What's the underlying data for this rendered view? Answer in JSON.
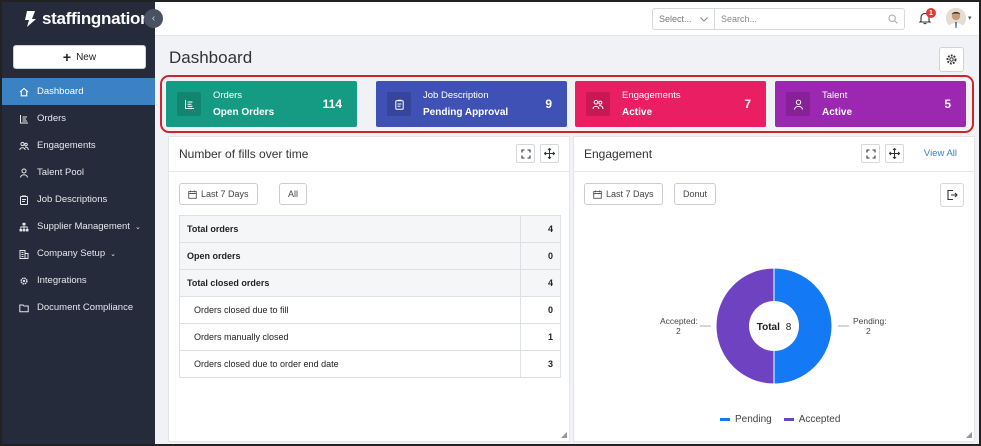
{
  "brand": {
    "name": "staffingnation",
    "reg": "®"
  },
  "sidebar": {
    "new_label": "New",
    "items": [
      {
        "label": "Dashboard",
        "icon": "home-icon"
      },
      {
        "label": "Orders",
        "icon": "orders-icon"
      },
      {
        "label": "Engagements",
        "icon": "engagements-icon"
      },
      {
        "label": "Talent Pool",
        "icon": "person-icon"
      },
      {
        "label": "Job Descriptions",
        "icon": "clipboard-icon"
      },
      {
        "label": "Supplier Management",
        "icon": "org-chart-icon"
      },
      {
        "label": "Company Setup",
        "icon": "company-icon"
      },
      {
        "label": "Integrations",
        "icon": "gear-icon"
      },
      {
        "label": "Document Compliance",
        "icon": "folder-icon"
      }
    ]
  },
  "topbar": {
    "select_placeholder": "Select...",
    "search_placeholder": "Search...",
    "notification_count": "1"
  },
  "page": {
    "title": "Dashboard"
  },
  "cards": [
    {
      "title": "Orders",
      "subtitle": "Open Orders",
      "value": "114",
      "color": "#159b83"
    },
    {
      "title": "Job Description",
      "subtitle": "Pending Approval",
      "value": "9",
      "color": "#3f51b5"
    },
    {
      "title": "Engagements",
      "subtitle": "Active",
      "value": "7",
      "color": "#e91e63"
    },
    {
      "title": "Talent",
      "subtitle": "Active",
      "value": "5",
      "color": "#9c27b0"
    }
  ],
  "fills_panel": {
    "title": "Number of fills over time",
    "filter_label": "Last 7 Days",
    "all_label": "All",
    "rows": [
      {
        "label": "Total orders",
        "value": "4"
      },
      {
        "label": "Open orders",
        "value": "0"
      },
      {
        "label": "Total closed orders",
        "value": "4"
      },
      {
        "label": "Orders closed due to fill",
        "value": "0"
      },
      {
        "label": "Orders manually closed",
        "value": "1"
      },
      {
        "label": "Orders closed due to order end date",
        "value": "3"
      }
    ]
  },
  "engagement_panel": {
    "title": "Engagement",
    "view_all": "View All",
    "filter_label": "Last 7 Days",
    "type_label": "Donut"
  },
  "chart_data": {
    "type": "pie",
    "donut": true,
    "center_label": "Total",
    "center_value": "8",
    "series": [
      {
        "name": "Pending",
        "value": 2,
        "label": "Pending:",
        "label_value": "2",
        "color": "#1479f5"
      },
      {
        "name": "Accepted",
        "value": 2,
        "label": "Accepted:",
        "label_value": "2",
        "color": "#6f42c1"
      }
    ],
    "legend": "bottom"
  }
}
